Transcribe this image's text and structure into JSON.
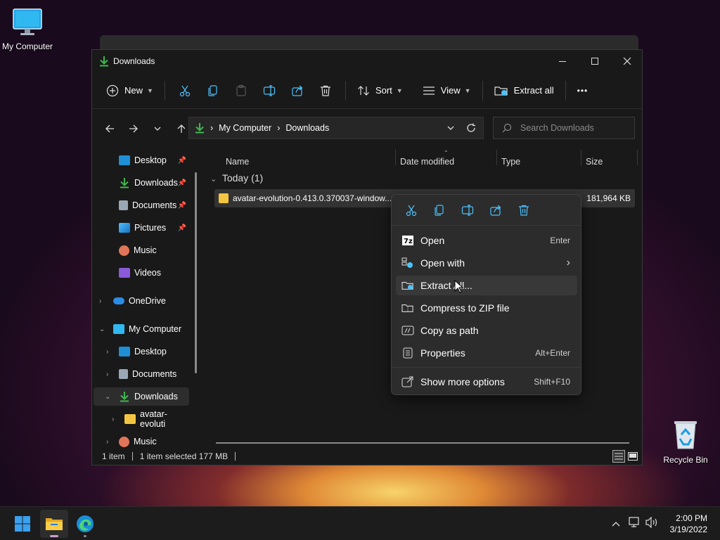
{
  "desktop": {
    "my_computer_label": "My Computer",
    "recycle_bin_label": "Recycle Bin"
  },
  "window": {
    "title": "Downloads",
    "controls": {
      "minimize": "—",
      "maximize": "☐",
      "close": "✕"
    }
  },
  "toolbar": {
    "new_label": "New",
    "sort_label": "Sort",
    "view_label": "View",
    "extract_all_label": "Extract all",
    "more_label": "•••"
  },
  "address": {
    "segments": [
      "My Computer",
      "Downloads"
    ],
    "search_placeholder": "Search Downloads"
  },
  "sidebar": {
    "quick_access": [
      {
        "label": "Desktop",
        "icon": "desktop-icon",
        "pinned": true
      },
      {
        "label": "Downloads",
        "icon": "download-icon",
        "pinned": true
      },
      {
        "label": "Documents",
        "icon": "documents-icon",
        "pinned": true
      },
      {
        "label": "Pictures",
        "icon": "pictures-icon",
        "pinned": true
      },
      {
        "label": "Music",
        "icon": "music-icon",
        "pinned": false
      },
      {
        "label": "Videos",
        "icon": "videos-icon",
        "pinned": false
      }
    ],
    "onedrive": "OneDrive",
    "my_computer": "My Computer",
    "tree": [
      {
        "label": "Desktop"
      },
      {
        "label": "Documents"
      },
      {
        "label": "Downloads",
        "selected": true
      },
      {
        "label": "avatar-evoluti"
      },
      {
        "label": "Music"
      }
    ]
  },
  "columns": {
    "name": "Name",
    "date_modified": "Date modified",
    "type": "Type",
    "size": "Size"
  },
  "files": {
    "group_label": "Today (1)",
    "rows": [
      {
        "name": "avatar-evolution-0.413.0.370037-window...",
        "size": "181,964 KB"
      }
    ]
  },
  "status": {
    "count": "1 item",
    "selection": "1 item selected  177 MB"
  },
  "context_menu": {
    "items": [
      {
        "label": "Open",
        "shortcut": "Enter"
      },
      {
        "label": "Open with",
        "shortcut": "›"
      },
      {
        "label": "Extract All...",
        "shortcut": ""
      },
      {
        "label": "Compress to ZIP file",
        "shortcut": ""
      },
      {
        "label": "Copy as path",
        "shortcut": ""
      },
      {
        "label": "Properties",
        "shortcut": "Alt+Enter"
      },
      {
        "label": "Show more options",
        "shortcut": "Shift+F10"
      }
    ]
  },
  "taskbar": {
    "time": "2:00 PM",
    "date": "3/19/2022"
  },
  "colors": {
    "accent": "#4cc2ff",
    "download_green": "#3fb950",
    "folder_yellow": "#f4c542"
  }
}
